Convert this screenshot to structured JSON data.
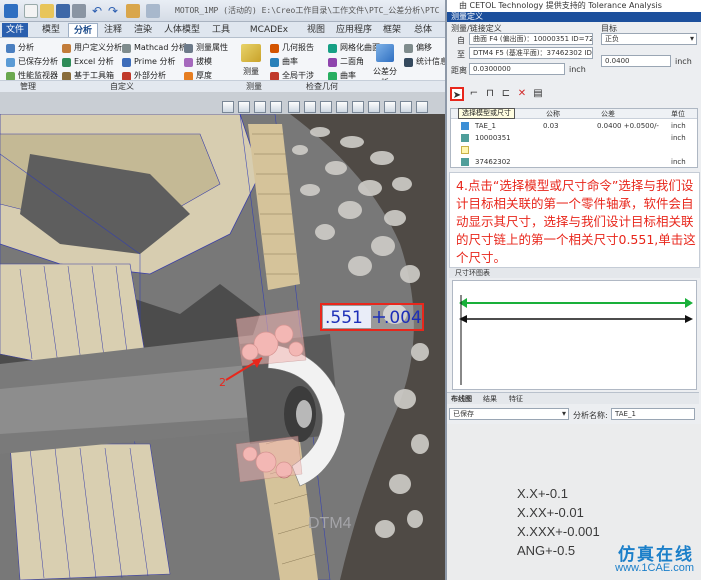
{
  "window": {
    "title": "MOTOR_1MP (活动的) E:\\Creo工作目录\\工作文件\\PTC_公差分析\\PTC"
  },
  "ribbon": {
    "tabs": [
      "文件",
      "模型",
      "分析",
      "注释",
      "渲染",
      "人体模型",
      "工具",
      "MCADEx Tools",
      "视图",
      "应用程序",
      "框架",
      "总体"
    ],
    "active_tab": "分析",
    "buttons": {
      "analysis": "分析",
      "saved_analysis": "已保存分析",
      "perf_monitor": "性能监视器",
      "user_defined": "用户定义分析",
      "excel": "Excel 分析",
      "toolbox": "基于工具箱",
      "mathcad": "Mathcad 分析",
      "prime": "Prime 分析",
      "external": "外部分析",
      "measure": "测量属性",
      "draft": "拔模",
      "thickness": "厚度",
      "measure_big": "测量",
      "geo_report": "几何报告",
      "mesh_surf": "网格化曲面",
      "sketch": "曲率",
      "dihedral": "二面角",
      "global_interf": "全局干涉",
      "curvature": "曲率",
      "tolerance": "公差分析",
      "offset": "偏移",
      "stats": "统计信息"
    },
    "groups": [
      "管理",
      "自定义",
      "测量",
      "检查几何"
    ]
  },
  "panel": {
    "title": "由 CETOL Technology 提供支持的 Tolerance Analysis",
    "header": "测量定义",
    "from_label": "测量/链接定义",
    "row_from": "曲面 F4 (偏出面)：10000351 ID=725",
    "row_to": "DTM4 F5 (基准平面)：37462302 ID=51",
    "prefix_from": "自",
    "prefix_to": "至",
    "distance_label": "距离",
    "distance_value": "0.0300000",
    "distance_unit": "inch",
    "target_label": "目标",
    "target_value": "正负",
    "target_number": "0.0400",
    "target_unit": "inch",
    "tooltip": "选择模型或尺寸",
    "table": {
      "headers": [
        "名称",
        "公称",
        "公差",
        "单位"
      ],
      "rows": [
        {
          "name": "TAE_1",
          "nominal": "0.03",
          "tolerance": "0.0400 +0.0500/-",
          "unit": "inch"
        },
        {
          "name": "10000351",
          "nominal": "",
          "tolerance": "",
          "unit": "inch"
        },
        {
          "name": "",
          "nominal": "",
          "tolerance": "",
          "unit": ""
        },
        {
          "name": "37462302",
          "nominal": "",
          "tolerance": "",
          "unit": "inch"
        }
      ]
    },
    "note": "4.点击“选择模型或尺寸命令”选择与我们设计目标相关联的第一个零件轴承，软件会自动显示其尺寸，选择与我们设计目标相关联的尺寸链上的第一个相关尺寸0.551,单击这个尺寸。",
    "loop_header": "尺寸环图表",
    "bottom_tabs": [
      "布线图",
      "结果",
      "特征"
    ],
    "status_value": "已保存",
    "analysis_name_label": "分析名称:",
    "analysis_name_value": "TAE_1"
  },
  "viewport": {
    "dimension_text": ".551",
    "tolerance_text": ".004",
    "datum_label": "DTM4",
    "callout_number": "2"
  },
  "ref_notes": [
    "X.X+-0.1",
    "X.XX+-0.01",
    "X.XXX+-0.001",
    "ANG+-0.5"
  ],
  "watermark": {
    "cn": "仿真在线",
    "en": "www.1CAE.com"
  },
  "colors": {
    "accent": "#1c4f9c",
    "note_red": "#e8271c",
    "part_pink": "#f3b7b4",
    "dimension_blue": "#1d2fb8",
    "loop_green": "#19b03a"
  }
}
